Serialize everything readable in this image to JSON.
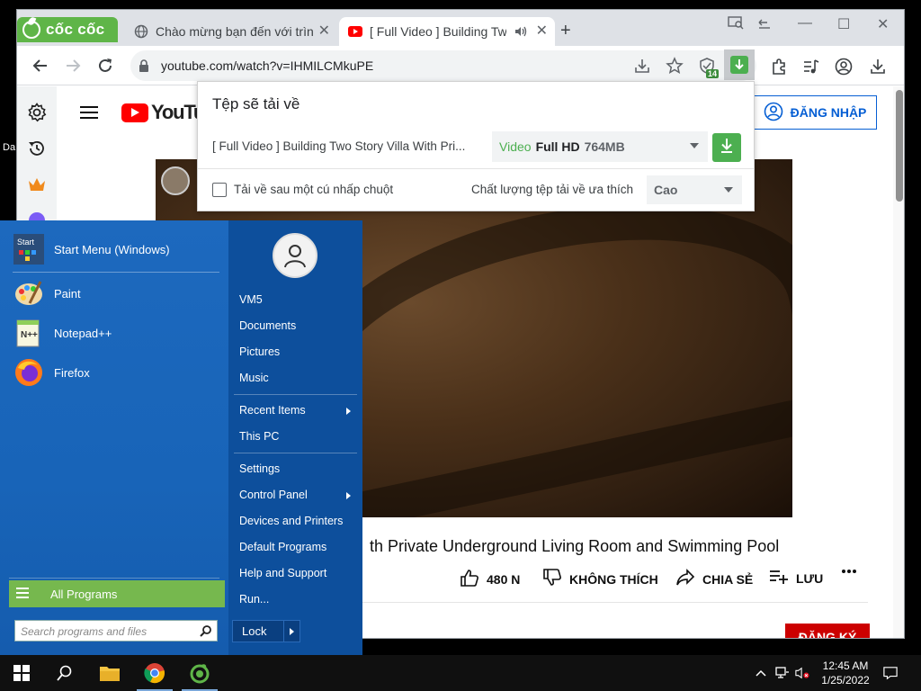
{
  "browser": {
    "brand": "cốc cốc",
    "tabs": [
      {
        "title": "Chào mừng bạn đến với trình duyệt"
      },
      {
        "title": "[ Full Video ] Building Two Story Villa"
      }
    ],
    "url": "youtube.com/watch?v=IHMILCMkuPE",
    "extension_badge": "14"
  },
  "youtube": {
    "logo_text": "YouTube",
    "signin_label": "ĐĂNG NHẬP",
    "video_title": "th Private Underground Living Room and Swimming Pool",
    "like_count": "480 N",
    "dislike_label": "KHÔNG THÍCH",
    "share_label": "CHIA SẺ",
    "save_label": "LƯU",
    "subscribe_label": "ĐĂNG KÝ"
  },
  "download_popup": {
    "title": "Tệp sẽ tải về",
    "file_name": "[ Full Video ] Building Two Story Villa With Pri...",
    "quality_source": "Video",
    "quality_res": "Full HD",
    "quality_size": "764MB",
    "one_click_label": "Tải về sau một cú nhấp chuột",
    "pref_label": "Chất lượng tệp tải về ưa thích",
    "pref_value": "Cao"
  },
  "start_menu": {
    "pinned": [
      {
        "label": "Start Menu (Windows)",
        "icon": "start-menu-icon"
      },
      {
        "label": "Paint",
        "icon": "paint-icon"
      },
      {
        "label": "Notepad++",
        "icon": "notepadpp-icon"
      },
      {
        "label": "Firefox",
        "icon": "firefox-icon"
      }
    ],
    "all_programs": "All Programs",
    "search_placeholder": "Search programs and files",
    "right": {
      "user": "VM5",
      "documents": "Documents",
      "pictures": "Pictures",
      "music": "Music",
      "recent_items": "Recent Items",
      "this_pc": "This PC",
      "settings": "Settings",
      "control_panel": "Control Panel",
      "devices_printers": "Devices and Printers",
      "default_programs": "Default Programs",
      "help_support": "Help and Support",
      "run": "Run..."
    },
    "lock_label": "Lock"
  },
  "desktop": {
    "fragment": "Da"
  },
  "taskbar": {
    "time": "12:45 AM",
    "date": "1/25/2022"
  },
  "colors": {
    "coccoc_green": "#5fb548",
    "youtube_red": "#ff0000",
    "start_blue": "#1a62b5",
    "all_programs_green": "#76b84e"
  }
}
